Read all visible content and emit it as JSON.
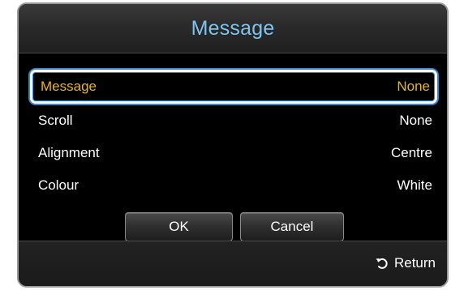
{
  "dialog": {
    "title": "Message",
    "rows": [
      {
        "label": "Message",
        "value": "None",
        "selected": true
      },
      {
        "label": "Scroll",
        "value": "None",
        "selected": false
      },
      {
        "label": "Alignment",
        "value": "Centre",
        "selected": false
      },
      {
        "label": "Colour",
        "value": "White",
        "selected": false
      }
    ],
    "buttons": {
      "ok_label": "OK",
      "cancel_label": "Cancel"
    },
    "footer": {
      "return_label": "Return",
      "return_icon": "return-arrow-icon"
    }
  },
  "colors": {
    "title": "#7fc4ee",
    "selected_text": "#e9b22f",
    "focus_border": "#ffffff",
    "focus_glow": "#3a86c9",
    "background": "#000000"
  }
}
